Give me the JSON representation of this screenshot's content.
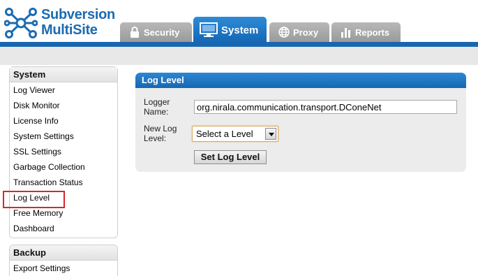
{
  "brand": {
    "line1": "Subversion",
    "line2": "MultiSite",
    "color": "#1b6bb3"
  },
  "tabs": [
    {
      "label": "Security",
      "icon": "lock-icon",
      "active": false
    },
    {
      "label": "System",
      "icon": "monitor-icon",
      "active": true
    },
    {
      "label": "Proxy",
      "icon": "globe-icon",
      "active": false
    },
    {
      "label": "Reports",
      "icon": "bar-chart-icon",
      "active": false
    }
  ],
  "sidebar": {
    "system": {
      "title": "System",
      "items": [
        {
          "label": "Log Viewer"
        },
        {
          "label": "Disk Monitor"
        },
        {
          "label": "License Info"
        },
        {
          "label": "System Settings"
        },
        {
          "label": "SSL Settings"
        },
        {
          "label": "Garbage Collection"
        },
        {
          "label": "Transaction Status"
        },
        {
          "label": "Log Level",
          "highlighted": true
        },
        {
          "label": "Free Memory"
        },
        {
          "label": "Dashboard"
        }
      ]
    },
    "backup": {
      "title": "Backup",
      "items": [
        {
          "label": "Export Settings"
        }
      ]
    }
  },
  "panel": {
    "title": "Log Level",
    "logger_label": "Logger Name:",
    "logger_value": "org.nirala.communication.transport.DConeNet",
    "level_label": "New Log Level:",
    "level_selected": "Select a Level",
    "button_label": "Set Log Level"
  },
  "colors": {
    "accent": "#1866b0",
    "highlight_border": "#d9262c",
    "inactive_tab": "#a8a8a8"
  }
}
